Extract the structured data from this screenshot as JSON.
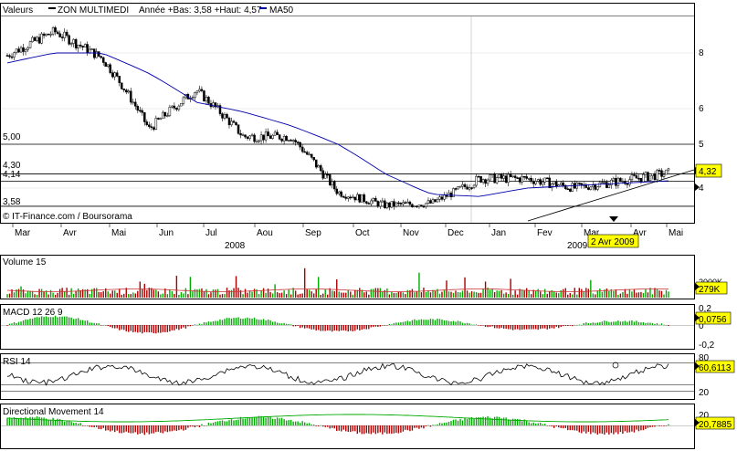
{
  "header": {
    "valeurs_label": "Valeurs",
    "symbol": "ZON MULTIMEDI",
    "range_text": "Année +Bas: 3,58 +Haut: 4,57",
    "ma_label": "MA50"
  },
  "credit": "© IT-Finance.com / Boursorama",
  "x_axis": {
    "months": [
      "Mar",
      "Avr",
      "Mai",
      "Jun",
      "Jul",
      "Aou",
      "Sep",
      "Oct",
      "Nov",
      "Dec",
      "Jan",
      "Fev",
      "Mar",
      "Avr",
      "Mai"
    ],
    "years": [
      "2008",
      "2009"
    ]
  },
  "date_tooltip": "2 Avr 2009",
  "price_panel": {
    "right_ticks": [
      "8",
      "6",
      "5",
      "4"
    ],
    "level_labels": [
      "5,00",
      "4,30",
      "4,14",
      "3,58"
    ],
    "last_value": "4,32"
  },
  "volume_panel": {
    "title": "Volume 15",
    "tick": "2000K",
    "last_value": "279K"
  },
  "macd_panel": {
    "title": "MACD 12 26 9",
    "ticks": [
      "0,2",
      "0",
      "-0,2"
    ],
    "last_value": "0,0756"
  },
  "rsi_panel": {
    "title": "RSI 14",
    "ticks": [
      "80",
      "20"
    ],
    "last_value": "60,6113"
  },
  "dm_panel": {
    "title": "Directional Movement 14",
    "ticks": [
      "20"
    ],
    "last_value": "20,7885"
  },
  "colors": {
    "candle": "#000000",
    "ma": "#0000aa",
    "volume_up": "#00aa00",
    "volume_down": "#aa0000",
    "dm_line": "#00aa00",
    "tag_bg": "#ffff00"
  },
  "chart_data": {
    "type": "line",
    "title": "ZON MULTIMEDI",
    "x": [
      "2008-03",
      "2008-04",
      "2008-05",
      "2008-06",
      "2008-07",
      "2008-08",
      "2008-09",
      "2008-10",
      "2008-11",
      "2008-12",
      "2009-01",
      "2009-02",
      "2009-03",
      "2009-04",
      "2009-05"
    ],
    "series": [
      {
        "name": "ZON MULTIMEDI",
        "values": [
          7.9,
          8.9,
          7.8,
          5.4,
          6.6,
          5.2,
          5.2,
          3.9,
          3.6,
          3.65,
          4.2,
          4.2,
          4.0,
          4.15,
          4.32
        ]
      },
      {
        "name": "MA50",
        "values": [
          7.6,
          8.0,
          8.0,
          7.2,
          6.2,
          5.9,
          5.5,
          5.0,
          4.3,
          3.85,
          3.8,
          4.0,
          4.05,
          4.1,
          4.15
        ]
      }
    ],
    "horizontal_levels": [
      5.0,
      4.3,
      4.14,
      3.58
    ],
    "y_log_ticks": [
      8,
      6,
      5,
      4
    ],
    "indicators": {
      "volume_15": {
        "last": 279000
      },
      "macd_12_26_9": {
        "last": 0.0756,
        "range": [
          -0.2,
          0.2
        ]
      },
      "rsi_14": {
        "last": 60.6113,
        "levels": [
          80,
          20
        ]
      },
      "dm_14": {
        "last": 20.7885
      }
    }
  }
}
